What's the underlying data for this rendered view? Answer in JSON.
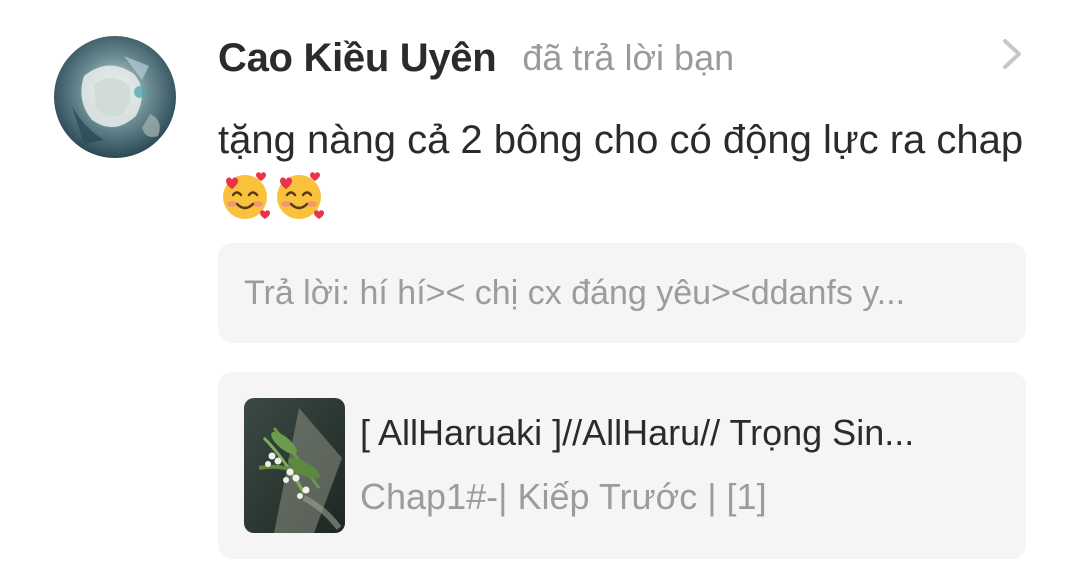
{
  "notification": {
    "avatar_icon": "user-avatar",
    "username": "Cao Kiều Uyên",
    "action": "đã trả lời bạn",
    "chevron_icon": "chevron-right-icon",
    "comment_text": "tặng nàng cả 2 bông cho có động lực ra chap",
    "comment_emojis": [
      "smiling-face-with-hearts",
      "smiling-face-with-hearts"
    ],
    "reply_preview": "Trả lời: hí hí>< chị cx đáng yêu><ddanfs y...",
    "story": {
      "cover_icon": "story-cover-image",
      "title": "[ AllHaruaki ]//AllHaru// Trọng Sin...",
      "chapter": "Chap1#-| Kiếp Trước | [1]"
    }
  },
  "colors": {
    "text_primary": "#2b2b2b",
    "text_secondary": "#9a9a9a",
    "card_background": "#f5f5f6",
    "chevron": "#c7c7c7"
  }
}
